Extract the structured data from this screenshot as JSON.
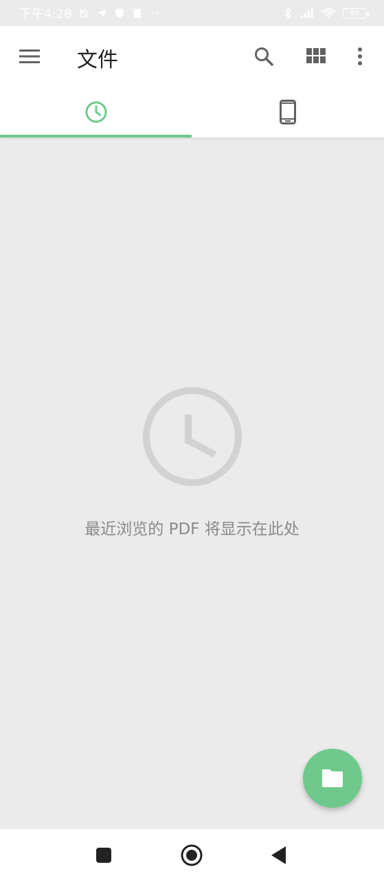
{
  "status_bar": {
    "time": "下午4:28",
    "battery": "83",
    "icons_left": [
      "mute-alarm-icon",
      "send-icon",
      "shield-icon",
      "delete-icon",
      "more-dots-icon"
    ],
    "icons_right": [
      "bluetooth-icon",
      "signal-icon",
      "wifi-icon",
      "battery-icon"
    ]
  },
  "app_bar": {
    "title": "文件",
    "icons": [
      "menu-icon",
      "search-icon",
      "grid-view-icon",
      "more-vert-icon"
    ]
  },
  "tabs": [
    {
      "name": "recent",
      "icon": "clock-icon",
      "selected": true
    },
    {
      "name": "device",
      "icon": "phone-icon",
      "selected": false
    }
  ],
  "empty_state": {
    "icon": "clock-icon",
    "message": "最近浏览的 PDF 将显示在此处"
  },
  "fab": {
    "icon": "folder-icon"
  },
  "nav_bar": {
    "icons": [
      "recents-square-icon",
      "home-circle-icon",
      "back-triangle-icon"
    ]
  },
  "colors": {
    "accent": "#6fc98d",
    "background": "#ebebeb",
    "surface": "#ffffff",
    "icon_gray": "#616161",
    "empty_icon": "#d2d2d2",
    "empty_text": "#8a8a8a"
  }
}
